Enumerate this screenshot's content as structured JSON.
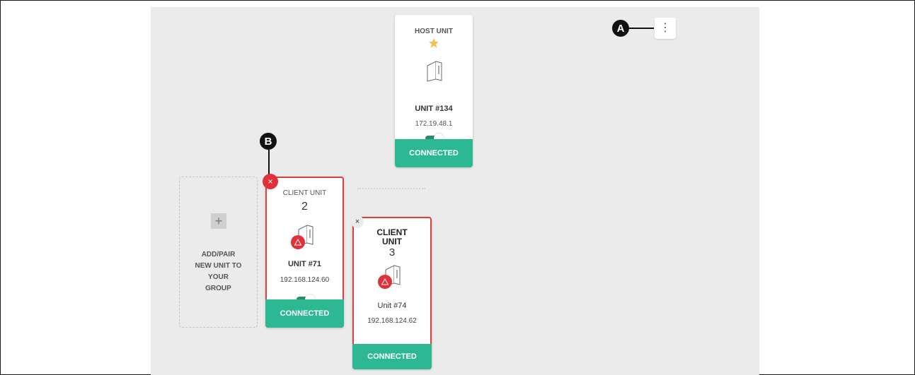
{
  "colors": {
    "connected_green": "#2bb893",
    "alert_red": "#e0313a",
    "card_border_red": "#d94040",
    "star_gold": "#f2c14e",
    "canvas_gray": "#ebebeb"
  },
  "callouts": {
    "a": "A",
    "b": "B"
  },
  "menu": {
    "icon": "more-vertical-icon",
    "glyph": "⋮"
  },
  "host_unit": {
    "title": "HOST UNIT",
    "star_icon": "star-icon",
    "device_icon": "device-icon",
    "unit_name": "UNIT #134",
    "ip": "172.19.48.1",
    "toggle_on": true,
    "status": "CONNECTED"
  },
  "add_unit": {
    "plus": "+",
    "label_lines": [
      "ADD/PAIR",
      "NEW UNIT TO",
      "YOUR",
      "GROUP"
    ]
  },
  "client_units": [
    {
      "title": "CLIENT UNIT",
      "number": "2",
      "remove_glyph": "×",
      "warning_icon": "warning-icon",
      "unit_name": "UNIT #71",
      "ip": "192.168.124.60",
      "toggle_on": true,
      "status": "CONNECTED"
    },
    {
      "title_line1": "CLIENT",
      "title_line2": "UNIT",
      "number": "3",
      "remove_glyph": "×",
      "warning_icon": "warning-icon",
      "unit_name": "Unit #74",
      "ip": "192.168.124.62",
      "status": "CONNECTED"
    }
  ]
}
